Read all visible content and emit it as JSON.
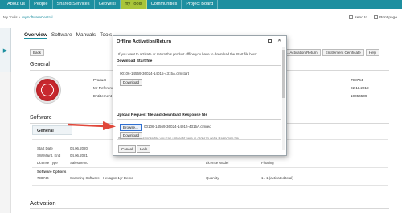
{
  "topnav": {
    "tabs": [
      "About us",
      "People",
      "Shared Services",
      "GeoWiki",
      "my Tools",
      "Communities",
      "Project Board"
    ],
    "active_index": 4,
    "active_color": "#a9c53a",
    "brand_color": "#1d8fa0"
  },
  "breadcrumbs": [
    "My Tools",
    "mySoftwareCentral"
  ],
  "topright": {
    "send": "send to",
    "print": "Print page"
  },
  "page_tabs": [
    "Overview",
    "Software",
    "Manuals",
    "Tools"
  ],
  "toolbar": {
    "back": "Back",
    "right": [
      "...Activation/Return",
      "Entitlement Certificate",
      "Help"
    ]
  },
  "general": {
    "heading": "General",
    "product_label": "Product",
    "product_value": "798744",
    "refcode_label": "Mr Reference",
    "refcode_value": "22.11.2019",
    "entitlement_label": "Entitlement",
    "entitlement_value": "10054509"
  },
  "software": {
    "heading": "Software",
    "subheading": "General",
    "start_label": "Start Date",
    "start_value": "04.06.2020",
    "maint_label": "SW Maint. End",
    "maint_value": "04.06.2021",
    "license_label": "License Type",
    "license_value": "SalesDemo",
    "license_model_label": "License Model",
    "license_model_value": "Floating",
    "options_label": "Software Options",
    "option_id": "798744",
    "option_desc": "Scanning Software - Hexagon 1yr Demo",
    "quantity_label": "Quantity",
    "quantity_value": "1 / 1 (activated/total)"
  },
  "activation": {
    "heading": "Activation"
  },
  "modal": {
    "title": "Offline Activation/Return",
    "intro": "If you want to activate or return this product offline you have to download the Start file here:",
    "download_heading": "Download Start file",
    "start_file": "00106-14569-36024-14015-4315A.clmstart",
    "download_label": "Download",
    "cut_text": "If you have a Response file you can upload it here in order to get a Response file",
    "upload_heading": "Upload Request file and download Response file",
    "browse_label": "Browse...",
    "upload_file": "00106-14569-36024-14015-4315A.clmreq",
    "download2_label": "Download",
    "cancel_label": "Cancel",
    "help_label": "Help"
  },
  "arrow_color": "#e0473a"
}
